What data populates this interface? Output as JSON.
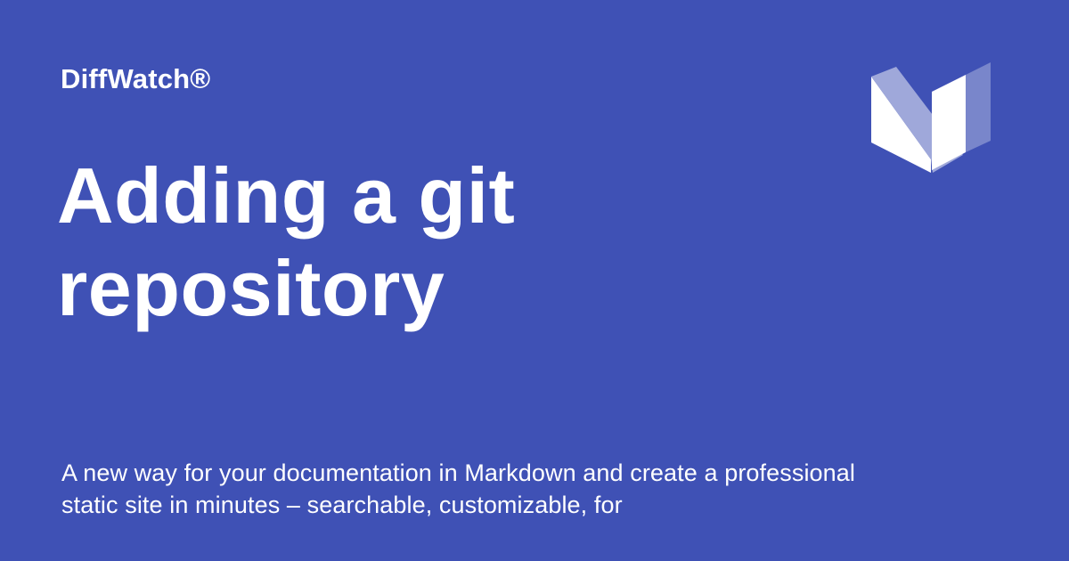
{
  "brand": {
    "name": "DiffWatch®",
    "background_color": "#3f51b5",
    "logo_icon": "stylized-m-logo-icon"
  },
  "page": {
    "title": "Adding a git repository",
    "description": "A new way for your documentation in Markdown and create a professional static site in minutes – searchable, customizable, for"
  }
}
